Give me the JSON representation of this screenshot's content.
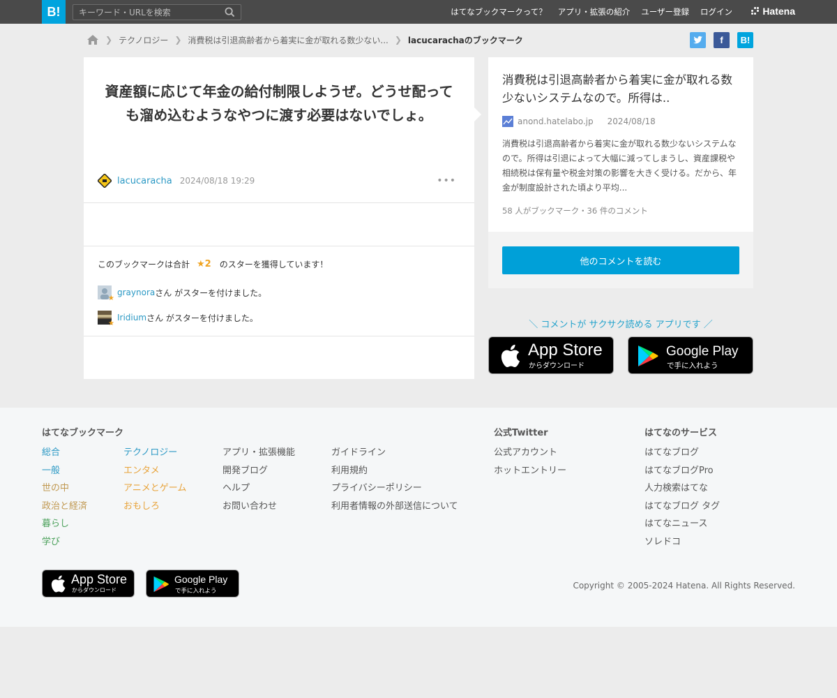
{
  "header": {
    "logo": "B!",
    "search_placeholder": "キーワード・URLを検索",
    "nav": [
      "はてなブックマークって？",
      "アプリ・拡張の紹介",
      "ユーザー登録",
      "ログイン"
    ],
    "brand": "Hatena"
  },
  "breadcrumb": {
    "items": [
      "テクノロジー",
      "消費税は引退高齢者から着実に金が取れる数少ない...",
      "lacucarachaのブックマーク"
    ]
  },
  "share": {
    "twitter": "t",
    "facebook": "f",
    "hatena": "B!"
  },
  "bookmark": {
    "comment": "資産額に応じて年金の給付制限しようぜ。どうせ配っても溜め込むようなやつに渡す必要はないでしょ。",
    "user": "lacucaracha",
    "timestamp": "2024/08/18 19:29",
    "more": "•••",
    "star_summary_prefix": "このブックマークは合計",
    "star_count": "★2",
    "star_summary_suffix": "のスターを獲得しています！",
    "stars": [
      {
        "user": "graynora",
        "suffix": "さん がスターを付けました。"
      },
      {
        "user": "Iridium",
        "suffix": "さん がスターを付けました。"
      }
    ]
  },
  "entry": {
    "title": "消費税は引退高齢者から着実に金が取れる数少ないシステムなので。所得は..",
    "domain": "anond.hatelabo.jp",
    "date": "2024/08/18",
    "description": "消費税は引退高齢者から着実に金が取れる数少ないシステムなので。所得は引退によって大幅に減ってしまうし、資産課税や相続税は保有量や税金対策の影響を大きく受ける。だから、年金が制度設計された頃より平均...",
    "stats": "58 人がブックマーク・36 件のコメント",
    "read_button": "他のコメントを読む"
  },
  "app_promo": {
    "tagline": "＼ コメントが サクサク読める アプリです ／",
    "app_store_main": "App Store",
    "app_store_sub": "からダウンロード",
    "google_play_main": "Google Play",
    "google_play_sub": "で手に入れよう"
  },
  "footer": {
    "bookmark_heading": "はてなブックマーク",
    "categories_1": [
      "総合",
      "一般",
      "世の中",
      "政治と経済",
      "暮らし",
      "学び"
    ],
    "categories_2": [
      "テクノロジー",
      "エンタメ",
      "アニメとゲーム",
      "おもしろ"
    ],
    "links_1": [
      "アプリ・拡張機能",
      "開発ブログ",
      "ヘルプ",
      "お問い合わせ"
    ],
    "links_2": [
      "ガイドライン",
      "利用規約",
      "プライバシーポリシー",
      "利用者情報の外部送信について"
    ],
    "twitter_heading": "公式Twitter",
    "twitter_links": [
      "公式アカウント",
      "ホットエントリー"
    ],
    "services_heading": "はてなのサービス",
    "services": [
      "はてなブログ",
      "はてなブログPro",
      "人力検索はてな",
      "はてなブログ タグ",
      "はてなニュース",
      "ソレドコ"
    ],
    "copyright": "Copyright © 2005-2024 Hatena. All Rights Reserved."
  },
  "colors": {
    "header_bg": "#4a4a4a",
    "brand_blue": "#00a4de",
    "link_blue": "#2a98c4",
    "star": "#f0a320",
    "button": "#00a0d8"
  }
}
